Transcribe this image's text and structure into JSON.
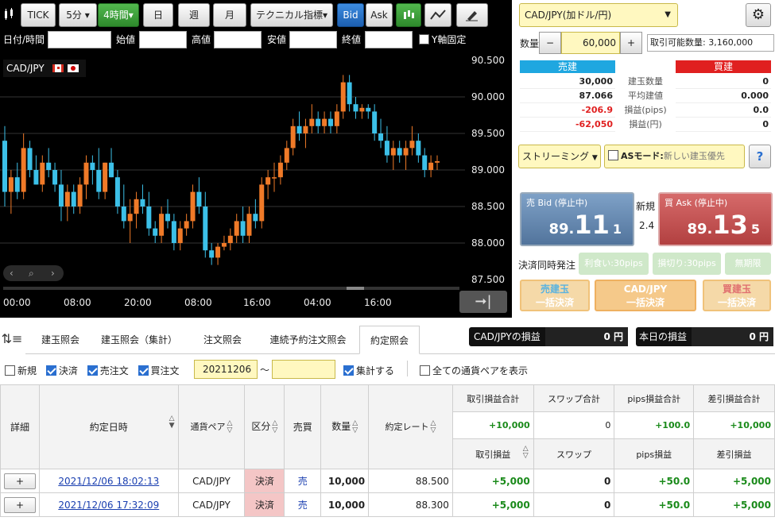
{
  "toolbar": {
    "tick": "TICK",
    "interval": "5分",
    "interval4h": "4時間",
    "day": "日",
    "week": "週",
    "month": "月",
    "tech": "テクニカル指標",
    "bid": "Bid",
    "ask": "Ask"
  },
  "ohlc": {
    "datetime": "日付/時間",
    "open": "始値",
    "high": "高値",
    "low": "安値",
    "close": "終値",
    "yfix": "Y軸固定"
  },
  "chart": {
    "pair": "CAD/JPY",
    "y_ticks": [
      "90.500",
      "90.000",
      "89.500",
      "89.000",
      "88.500",
      "88.000",
      "87.500"
    ],
    "x_ticks": [
      "00:00",
      "08:00",
      "20:00",
      "08:00",
      "16:00",
      "04:00",
      "16:00"
    ]
  },
  "chart_data": {
    "type": "candlestick",
    "ylim": [
      87.5,
      90.5
    ],
    "candles": [
      [
        89.4,
        89.6,
        88.5,
        88.7
      ],
      [
        88.7,
        89.0,
        88.4,
        88.9
      ],
      [
        88.9,
        89.1,
        88.6,
        88.7
      ],
      [
        88.7,
        89.5,
        88.6,
        89.3
      ],
      [
        89.3,
        89.4,
        88.9,
        89.0
      ],
      [
        89.0,
        89.2,
        88.8,
        88.8
      ],
      [
        88.8,
        89.2,
        88.7,
        89.1
      ],
      [
        89.1,
        89.3,
        88.9,
        89.0
      ],
      [
        89.0,
        89.1,
        88.7,
        88.8
      ],
      [
        88.8,
        89.0,
        88.3,
        88.5
      ],
      [
        88.5,
        88.8,
        88.3,
        88.7
      ],
      [
        88.7,
        88.8,
        88.4,
        88.5
      ],
      [
        88.5,
        88.9,
        88.4,
        88.8
      ],
      [
        88.8,
        89.2,
        88.6,
        89.1
      ],
      [
        89.1,
        89.2,
        88.8,
        89.0
      ],
      [
        89.0,
        89.3,
        88.6,
        88.7
      ],
      [
        88.7,
        89.1,
        88.6,
        89.1
      ],
      [
        89.1,
        89.3,
        88.9,
        88.9
      ],
      [
        88.9,
        89.0,
        88.4,
        88.5
      ],
      [
        88.5,
        88.8,
        88.2,
        88.3
      ],
      [
        88.3,
        88.6,
        88.0,
        88.4
      ],
      [
        88.4,
        88.7,
        88.2,
        88.6
      ],
      [
        88.6,
        88.8,
        88.4,
        88.5
      ],
      [
        88.5,
        88.7,
        88.1,
        88.2
      ],
      [
        88.2,
        88.3,
        88.0,
        88.1
      ],
      [
        88.1,
        88.5,
        88.0,
        88.4
      ],
      [
        88.4,
        88.6,
        88.2,
        88.3
      ],
      [
        88.3,
        88.4,
        87.9,
        88.0
      ],
      [
        88.0,
        88.3,
        87.9,
        88.2
      ],
      [
        88.2,
        88.4,
        88.1,
        88.3
      ],
      [
        88.3,
        88.8,
        88.2,
        88.7
      ],
      [
        88.7,
        88.9,
        88.4,
        88.5
      ],
      [
        88.5,
        88.7,
        87.8,
        87.9
      ],
      [
        87.9,
        88.0,
        87.7,
        87.8
      ],
      [
        87.8,
        88.0,
        87.7,
        87.95
      ],
      [
        87.95,
        88.1,
        87.9,
        88.0
      ],
      [
        88.0,
        88.2,
        87.9,
        88.1
      ],
      [
        88.1,
        88.4,
        88.0,
        88.3
      ],
      [
        88.3,
        88.5,
        88.0,
        88.1
      ],
      [
        88.1,
        88.5,
        88.0,
        88.4
      ],
      [
        88.4,
        88.6,
        88.2,
        88.3
      ],
      [
        88.3,
        88.9,
        88.2,
        88.8
      ],
      [
        88.8,
        89.0,
        88.6,
        88.9
      ],
      [
        88.9,
        89.1,
        88.7,
        88.9
      ],
      [
        88.9,
        89.2,
        88.8,
        89.1
      ],
      [
        89.1,
        89.4,
        89.0,
        89.3
      ],
      [
        89.3,
        89.7,
        89.2,
        89.6
      ],
      [
        89.6,
        89.8,
        89.4,
        89.5
      ],
      [
        89.5,
        89.7,
        89.3,
        89.6
      ],
      [
        89.6,
        89.9,
        89.5,
        89.7
      ],
      [
        89.7,
        89.8,
        89.5,
        89.6
      ],
      [
        89.6,
        89.8,
        89.5,
        89.7
      ],
      [
        89.7,
        89.8,
        89.5,
        89.6
      ],
      [
        89.6,
        89.9,
        89.5,
        89.8
      ],
      [
        89.8,
        90.3,
        89.7,
        90.2
      ],
      [
        90.2,
        90.3,
        89.8,
        89.9
      ],
      [
        89.9,
        90.0,
        89.7,
        89.8
      ],
      [
        89.8,
        89.9,
        89.7,
        89.85
      ],
      [
        89.85,
        89.9,
        89.7,
        89.8
      ],
      [
        89.8,
        89.9,
        89.4,
        89.5
      ],
      [
        89.5,
        89.7,
        89.3,
        89.4
      ],
      [
        89.4,
        89.6,
        89.1,
        89.2
      ],
      [
        89.2,
        89.4,
        89.0,
        89.3
      ],
      [
        89.3,
        89.4,
        89.1,
        89.2
      ],
      [
        89.2,
        89.4,
        89.0,
        89.3
      ],
      [
        89.3,
        89.6,
        89.2,
        89.4
      ],
      [
        89.4,
        89.5,
        89.1,
        89.2
      ],
      [
        89.2,
        89.3,
        88.9,
        89.0
      ],
      [
        89.0,
        89.2,
        88.9,
        89.1
      ],
      [
        89.1,
        89.2,
        89.0,
        89.12
      ]
    ]
  },
  "order": {
    "pair": "CAD/JPY(加ドル/円)",
    "qty_label": "数量",
    "minus": "−",
    "qty": "60,000",
    "plus": "+",
    "available": "取引可能数量: 3,160,000"
  },
  "position": {
    "sell_header": "売建",
    "buy_header": "買建",
    "rows": [
      {
        "label": "建玉数量",
        "sell": "30,000",
        "buy": "0"
      },
      {
        "label": "平均建値",
        "sell": "87.066",
        "buy": "0.000"
      },
      {
        "label": "損益(pips)",
        "sell": "-206.9",
        "buy": "0.0"
      },
      {
        "label": "損益(円)",
        "sell": "-62,050",
        "buy": "0"
      }
    ]
  },
  "streaming": {
    "mode": "ストリーミング",
    "as_label": "ASモード:",
    "as_value": "新しい建玉優先",
    "help": "?"
  },
  "quote": {
    "bid_title": "売 Bid (停止中)",
    "bid_a": "89.",
    "bid_b": "11",
    "bid_c": "1",
    "mid_label": "新規",
    "spread": "2.4",
    "ask_title": "買 Ask (停止中)",
    "ask_a": "89.",
    "ask_b": "13",
    "ask_c": "5"
  },
  "settle": {
    "label": "決済同時発注",
    "profit": "利食い:30pips",
    "loss": "損切り:30pips",
    "none": "無期限"
  },
  "bulk": {
    "sell1": "売建玉",
    "sell2": "一括決済",
    "pair1": "CAD/JPY",
    "pair2": "一括決済",
    "buy1": "買建玉",
    "buy2": "一括決済"
  },
  "tabs": [
    "建玉照会",
    "建玉照会（集計）",
    "注文照会",
    "連続予約注文照会",
    "約定照会"
  ],
  "pl_boxes": {
    "pair_label": "CAD/JPYの損益",
    "pair_value": "0 円",
    "today_label": "本日の損益",
    "today_value": "0 円"
  },
  "filters": {
    "new": "新規",
    "settle": "決済",
    "sell": "売注文",
    "buy": "買注文",
    "date_from": "20211206",
    "tilde": "〜",
    "aggregate": "集計する",
    "all_pairs": "全ての通貨ペアを表示"
  },
  "grid": {
    "detail": "詳細",
    "exec_date": "約定日時",
    "pair": "通貨ペア",
    "kind": "区分",
    "side": "売買",
    "qty": "数量",
    "rate": "約定レート",
    "sum_headers": [
      "取引損益合計",
      "スワップ合計",
      "pips損益合計",
      "差引損益合計"
    ],
    "sum_values": [
      "+10,000",
      "0",
      "+100.0",
      "+10,000"
    ],
    "sub_headers": [
      "取引損益",
      "スワップ",
      "pips損益",
      "差引損益"
    ],
    "rows": [
      {
        "btn": "+",
        "date": "2021/12/06 18:02:13",
        "pair": "CAD/JPY",
        "kind": "決済",
        "side": "売",
        "qty": "10,000",
        "rate": "88.500",
        "pl": "+5,000",
        "swap": "0",
        "pips": "+50.0",
        "net": "+5,000"
      },
      {
        "btn": "+",
        "date": "2021/12/06 17:32:09",
        "pair": "CAD/JPY",
        "kind": "決済",
        "side": "売",
        "qty": "10,000",
        "rate": "88.300",
        "pl": "+5,000",
        "swap": "0",
        "pips": "+50.0",
        "net": "+5,000"
      }
    ]
  }
}
